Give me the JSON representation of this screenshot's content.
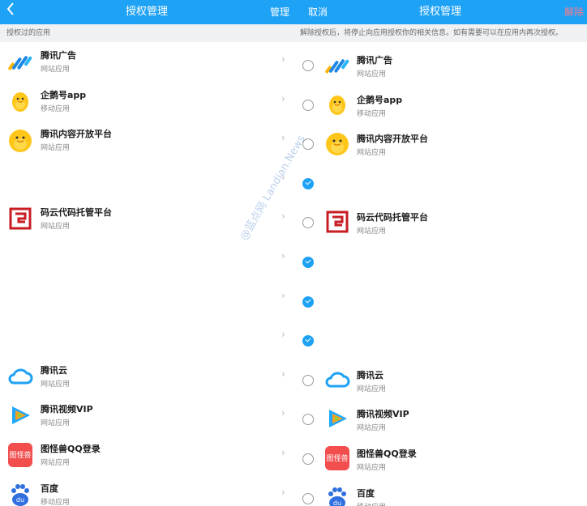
{
  "left": {
    "title": "授权管理",
    "back_icon": "chevron-left-icon",
    "manage_label": "管理",
    "section_label": "授权过的应用",
    "items": [
      {
        "name": "腾讯广告",
        "type": "网站应用",
        "icon": "tencent-ads-icon"
      },
      {
        "name": "企鹅号app",
        "type": "移动应用",
        "icon": "penguin-icon"
      },
      {
        "name": "腾讯内容开放平台",
        "type": "网站应用",
        "icon": "penguin-large-icon"
      },
      {
        "name": "",
        "type": "",
        "icon": ""
      },
      {
        "name": "码云代码托管平台",
        "type": "网站应用",
        "icon": "gitee-icon"
      },
      {
        "name": "",
        "type": "",
        "icon": ""
      },
      {
        "name": "",
        "type": "",
        "icon": ""
      },
      {
        "name": "",
        "type": "",
        "icon": ""
      },
      {
        "name": "腾讯云",
        "type": "网站应用",
        "icon": "tencent-cloud-icon"
      },
      {
        "name": "腾讯视频VIP",
        "type": "网站应用",
        "icon": "tencent-video-icon"
      },
      {
        "name": "图怪兽QQ登录",
        "type": "网站应用",
        "icon": "tuguaishou-icon"
      },
      {
        "name": "百度",
        "type": "移动应用",
        "icon": "baidu-icon"
      }
    ]
  },
  "right": {
    "title": "授权管理",
    "cancel_label": "取消",
    "revoke_label": "解除",
    "notice": "解除授权后，将停止向应用授权你的相关信息。如有需要可以在应用内再次授权。",
    "items": [
      {
        "name": "腾讯广告",
        "type": "网站应用",
        "checked": false
      },
      {
        "name": "企鹅号app",
        "type": "移动应用",
        "checked": false
      },
      {
        "name": "腾讯内容开放平台",
        "type": "网站应用",
        "checked": false
      },
      {
        "name": "",
        "type": "",
        "checked": true
      },
      {
        "name": "码云代码托管平台",
        "type": "网站应用",
        "checked": false
      },
      {
        "name": "",
        "type": "",
        "checked": true
      },
      {
        "name": "",
        "type": "",
        "checked": true
      },
      {
        "name": "",
        "type": "",
        "checked": true
      },
      {
        "name": "腾讯云",
        "type": "网站应用",
        "checked": false
      },
      {
        "name": "腾讯视频VIP",
        "type": "网站应用",
        "checked": false
      },
      {
        "name": "图怪兽QQ登录",
        "type": "网站应用",
        "checked": false
      },
      {
        "name": "百度",
        "type": "移动应用",
        "checked": false
      }
    ]
  },
  "watermark": "@蓝点网 Landian.News",
  "colors": {
    "accent": "#1ea2f5",
    "revoke": "#ff7b8a"
  }
}
